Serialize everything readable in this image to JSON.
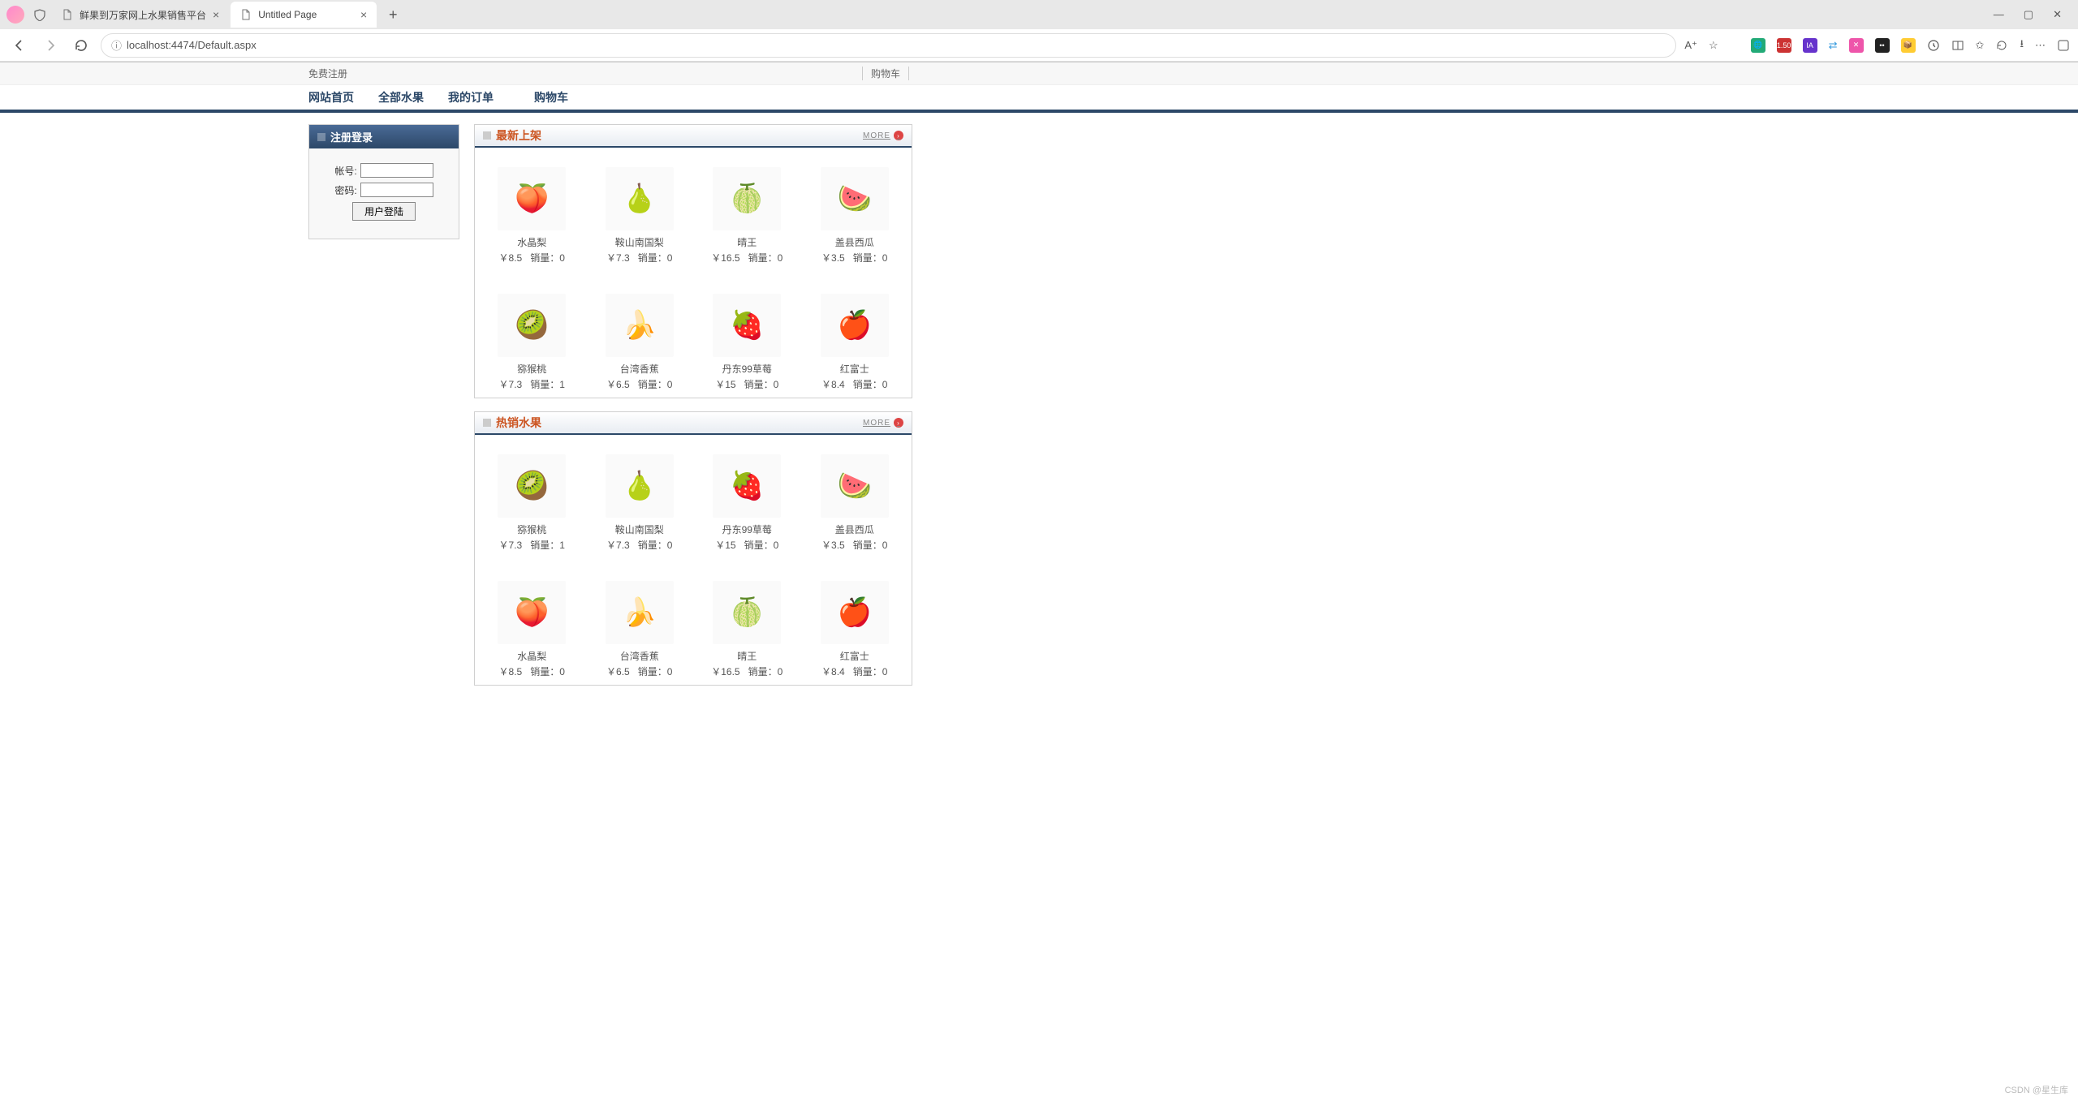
{
  "browser": {
    "tabs": [
      {
        "title": "鲜果到万家网上水果销售平台",
        "active": false
      },
      {
        "title": "Untitled Page",
        "active": true
      }
    ],
    "url": "localhost:4474/Default.aspx",
    "window_controls": {
      "min": "—",
      "max": "▢",
      "close": "✕"
    }
  },
  "topbar": {
    "register": "免费注册",
    "cart": "购物车"
  },
  "nav": {
    "items": [
      "网站首页",
      "全部水果",
      "我的订单",
      "购物车"
    ]
  },
  "login": {
    "header": "注册登录",
    "account_label": "帐号:",
    "password_label": "密码:",
    "button": "用户登陆"
  },
  "panels": [
    {
      "title": "最新上架",
      "more": "MORE",
      "products": [
        {
          "name": "水晶梨",
          "price": "￥8.5",
          "sales_label": "销量：",
          "sales": "0",
          "emoji": "🍑"
        },
        {
          "name": "鞍山南国梨",
          "price": "￥7.3",
          "sales_label": "销量：",
          "sales": "0",
          "emoji": "🍐"
        },
        {
          "name": "晴王",
          "price": "￥16.5",
          "sales_label": "销量：",
          "sales": "0",
          "emoji": "🍈"
        },
        {
          "name": "盖县西瓜",
          "price": "￥3.5",
          "sales_label": "销量：",
          "sales": "0",
          "emoji": "🍉"
        },
        {
          "name": "猕猴桃",
          "price": "￥7.3",
          "sales_label": "销量：",
          "sales": "1",
          "emoji": "🥝"
        },
        {
          "name": "台湾香蕉",
          "price": "￥6.5",
          "sales_label": "销量：",
          "sales": "0",
          "emoji": "🍌"
        },
        {
          "name": "丹东99草莓",
          "price": "￥15",
          "sales_label": "销量：",
          "sales": "0",
          "emoji": "🍓"
        },
        {
          "name": "红富士",
          "price": "￥8.4",
          "sales_label": "销量：",
          "sales": "0",
          "emoji": "🍎"
        }
      ]
    },
    {
      "title": "热销水果",
      "more": "MORE",
      "products": [
        {
          "name": "猕猴桃",
          "price": "￥7.3",
          "sales_label": "销量：",
          "sales": "1",
          "emoji": "🥝"
        },
        {
          "name": "鞍山南国梨",
          "price": "￥7.3",
          "sales_label": "销量：",
          "sales": "0",
          "emoji": "🍐"
        },
        {
          "name": "丹东99草莓",
          "price": "￥15",
          "sales_label": "销量：",
          "sales": "0",
          "emoji": "🍓"
        },
        {
          "name": "盖县西瓜",
          "price": "￥3.5",
          "sales_label": "销量：",
          "sales": "0",
          "emoji": "🍉"
        },
        {
          "name": "水晶梨",
          "price": "￥8.5",
          "sales_label": "销量：",
          "sales": "0",
          "emoji": "🍑"
        },
        {
          "name": "台湾香蕉",
          "price": "￥6.5",
          "sales_label": "销量：",
          "sales": "0",
          "emoji": "🍌"
        },
        {
          "name": "晴王",
          "price": "￥16.5",
          "sales_label": "销量：",
          "sales": "0",
          "emoji": "🍈"
        },
        {
          "name": "红富士",
          "price": "￥8.4",
          "sales_label": "销量：",
          "sales": "0",
          "emoji": "🍎"
        }
      ]
    }
  ],
  "watermark": "CSDN @星生库"
}
